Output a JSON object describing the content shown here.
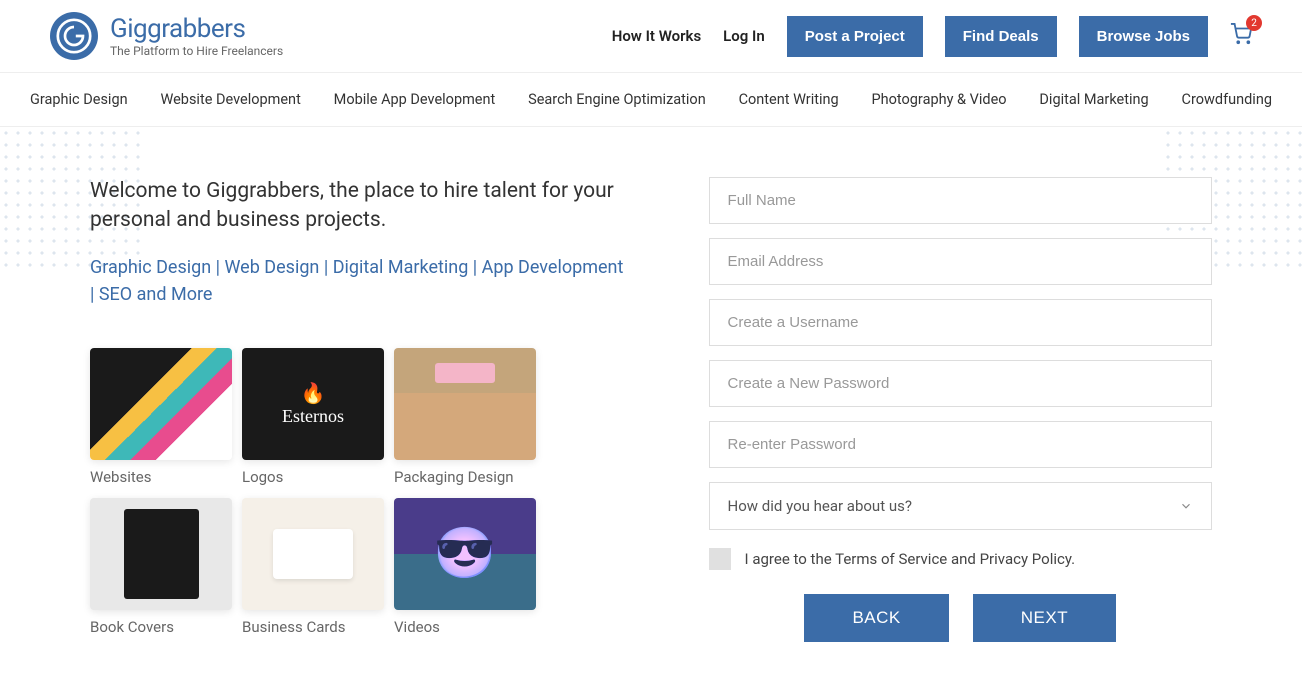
{
  "logo": {
    "title": "Giggrabbers",
    "subtitle": "The Platform to Hire Freelancers"
  },
  "nav": {
    "how_it_works": "How It Works",
    "log_in": "Log In",
    "post_project": "Post a Project",
    "find_deals": "Find Deals",
    "browse_jobs": "Browse Jobs",
    "cart_count": "2"
  },
  "categories": [
    "Graphic Design",
    "Website Development",
    "Mobile App Development",
    "Search Engine Optimization",
    "Content Writing",
    "Photography & Video",
    "Digital Marketing",
    "Crowdfunding"
  ],
  "welcome": {
    "heading": "Welcome to Giggrabbers, the place to hire talent for your personal and business projects.",
    "tags": "Graphic Design | Web Design | Digital Marketing | App Development | SEO and More"
  },
  "thumbs": [
    {
      "label": "Websites"
    },
    {
      "label": "Logos"
    },
    {
      "label": "Packaging Design"
    },
    {
      "label": "Book Covers"
    },
    {
      "label": "Business Cards"
    },
    {
      "label": "Videos"
    }
  ],
  "form": {
    "full_name": "Full Name",
    "email": "Email Address",
    "username": "Create a Username",
    "password": "Create a New Password",
    "repassword": "Re-enter Password",
    "hear_about": "How did you hear about us?",
    "agree": "I agree to the Terms of Service and Privacy Policy.",
    "back": "BACK",
    "next": "NEXT"
  }
}
